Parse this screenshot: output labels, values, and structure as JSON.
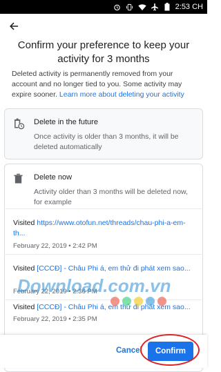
{
  "status": {
    "time": "2:53 CH"
  },
  "header": {
    "title": "Confirm your preference to keep your activity for 3 months"
  },
  "description": {
    "text": "Deleted activity is permanently removed from your account and no longer tied to you. Some activity may expire sooner.",
    "link": "Learn more about deleting your activity"
  },
  "future_card": {
    "heading": "Delete in the future",
    "body": "Once activity is older than 3 months, it will be deleted automatically"
  },
  "now_card": {
    "heading": "Delete now",
    "body": "Activity older than 3 months will be deleted now, for example",
    "items": [
      {
        "prefix": "Visited",
        "link": "https://www.otofun.net/threads/chau-phi-a-em-th...",
        "time": "February 22, 2019 • 2:42 PM"
      },
      {
        "prefix": "Visited",
        "link": "[CCCĐ] - Châu Phi á, em thử đi phát xem sao...",
        "time": "February 22, 2019 • 2:36 PM"
      },
      {
        "prefix": "Visited",
        "link": "[CCCĐ] - Châu Phi á, em thử đi phát xem sao...",
        "time": "February 22, 2019 • 2:35 PM"
      }
    ]
  },
  "footer": {
    "cancel": "Cancel",
    "confirm": "Confirm"
  },
  "watermark": {
    "text": "Download.com.vn"
  },
  "watermark_dots": [
    "#e84c3d",
    "#2ecc71",
    "#f1c40f",
    "#3498db",
    "#e74c3c"
  ],
  "colors": {
    "accent": "#1a73e8",
    "highlight_ring": "#e02020"
  },
  "icons": [
    "back-arrow-icon",
    "trash-clock-icon",
    "trash-icon"
  ]
}
